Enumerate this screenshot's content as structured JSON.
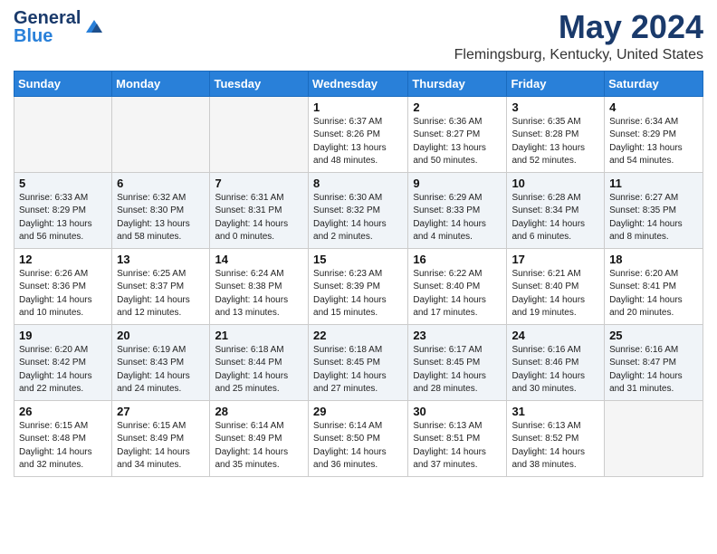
{
  "header": {
    "logo_line1": "General",
    "logo_line2": "Blue",
    "title": "May 2024",
    "location": "Flemingsburg, Kentucky, United States"
  },
  "weekdays": [
    "Sunday",
    "Monday",
    "Tuesday",
    "Wednesday",
    "Thursday",
    "Friday",
    "Saturday"
  ],
  "weeks": [
    [
      {
        "day": "",
        "empty": true
      },
      {
        "day": "",
        "empty": true
      },
      {
        "day": "",
        "empty": true
      },
      {
        "day": "1",
        "sunrise": "6:37 AM",
        "sunset": "8:26 PM",
        "daylight": "13 hours and 48 minutes."
      },
      {
        "day": "2",
        "sunrise": "6:36 AM",
        "sunset": "8:27 PM",
        "daylight": "13 hours and 50 minutes."
      },
      {
        "day": "3",
        "sunrise": "6:35 AM",
        "sunset": "8:28 PM",
        "daylight": "13 hours and 52 minutes."
      },
      {
        "day": "4",
        "sunrise": "6:34 AM",
        "sunset": "8:29 PM",
        "daylight": "13 hours and 54 minutes."
      }
    ],
    [
      {
        "day": "5",
        "sunrise": "6:33 AM",
        "sunset": "8:29 PM",
        "daylight": "13 hours and 56 minutes."
      },
      {
        "day": "6",
        "sunrise": "6:32 AM",
        "sunset": "8:30 PM",
        "daylight": "13 hours and 58 minutes."
      },
      {
        "day": "7",
        "sunrise": "6:31 AM",
        "sunset": "8:31 PM",
        "daylight": "14 hours and 0 minutes."
      },
      {
        "day": "8",
        "sunrise": "6:30 AM",
        "sunset": "8:32 PM",
        "daylight": "14 hours and 2 minutes."
      },
      {
        "day": "9",
        "sunrise": "6:29 AM",
        "sunset": "8:33 PM",
        "daylight": "14 hours and 4 minutes."
      },
      {
        "day": "10",
        "sunrise": "6:28 AM",
        "sunset": "8:34 PM",
        "daylight": "14 hours and 6 minutes."
      },
      {
        "day": "11",
        "sunrise": "6:27 AM",
        "sunset": "8:35 PM",
        "daylight": "14 hours and 8 minutes."
      }
    ],
    [
      {
        "day": "12",
        "sunrise": "6:26 AM",
        "sunset": "8:36 PM",
        "daylight": "14 hours and 10 minutes."
      },
      {
        "day": "13",
        "sunrise": "6:25 AM",
        "sunset": "8:37 PM",
        "daylight": "14 hours and 12 minutes."
      },
      {
        "day": "14",
        "sunrise": "6:24 AM",
        "sunset": "8:38 PM",
        "daylight": "14 hours and 13 minutes."
      },
      {
        "day": "15",
        "sunrise": "6:23 AM",
        "sunset": "8:39 PM",
        "daylight": "14 hours and 15 minutes."
      },
      {
        "day": "16",
        "sunrise": "6:22 AM",
        "sunset": "8:40 PM",
        "daylight": "14 hours and 17 minutes."
      },
      {
        "day": "17",
        "sunrise": "6:21 AM",
        "sunset": "8:40 PM",
        "daylight": "14 hours and 19 minutes."
      },
      {
        "day": "18",
        "sunrise": "6:20 AM",
        "sunset": "8:41 PM",
        "daylight": "14 hours and 20 minutes."
      }
    ],
    [
      {
        "day": "19",
        "sunrise": "6:20 AM",
        "sunset": "8:42 PM",
        "daylight": "14 hours and 22 minutes."
      },
      {
        "day": "20",
        "sunrise": "6:19 AM",
        "sunset": "8:43 PM",
        "daylight": "14 hours and 24 minutes."
      },
      {
        "day": "21",
        "sunrise": "6:18 AM",
        "sunset": "8:44 PM",
        "daylight": "14 hours and 25 minutes."
      },
      {
        "day": "22",
        "sunrise": "6:18 AM",
        "sunset": "8:45 PM",
        "daylight": "14 hours and 27 minutes."
      },
      {
        "day": "23",
        "sunrise": "6:17 AM",
        "sunset": "8:45 PM",
        "daylight": "14 hours and 28 minutes."
      },
      {
        "day": "24",
        "sunrise": "6:16 AM",
        "sunset": "8:46 PM",
        "daylight": "14 hours and 30 minutes."
      },
      {
        "day": "25",
        "sunrise": "6:16 AM",
        "sunset": "8:47 PM",
        "daylight": "14 hours and 31 minutes."
      }
    ],
    [
      {
        "day": "26",
        "sunrise": "6:15 AM",
        "sunset": "8:48 PM",
        "daylight": "14 hours and 32 minutes."
      },
      {
        "day": "27",
        "sunrise": "6:15 AM",
        "sunset": "8:49 PM",
        "daylight": "14 hours and 34 minutes."
      },
      {
        "day": "28",
        "sunrise": "6:14 AM",
        "sunset": "8:49 PM",
        "daylight": "14 hours and 35 minutes."
      },
      {
        "day": "29",
        "sunrise": "6:14 AM",
        "sunset": "8:50 PM",
        "daylight": "14 hours and 36 minutes."
      },
      {
        "day": "30",
        "sunrise": "6:13 AM",
        "sunset": "8:51 PM",
        "daylight": "14 hours and 37 minutes."
      },
      {
        "day": "31",
        "sunrise": "6:13 AM",
        "sunset": "8:52 PM",
        "daylight": "14 hours and 38 minutes."
      },
      {
        "day": "",
        "empty": true
      }
    ]
  ],
  "labels": {
    "sunrise_prefix": "Sunrise: ",
    "sunset_prefix": "Sunset: ",
    "daylight_prefix": "Daylight: "
  }
}
